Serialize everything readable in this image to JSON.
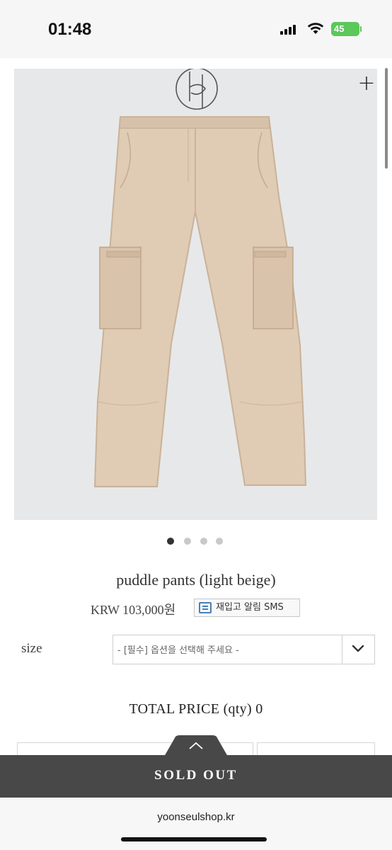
{
  "status_bar": {
    "time": "01:48",
    "battery": "45"
  },
  "gallery": {
    "image_count": 4,
    "active_index": 0,
    "zoom_label": "+"
  },
  "product": {
    "name": "puddle pants (light beige)",
    "price": "KRW 103,000원",
    "restock_button": "재입고 알림 SMS"
  },
  "options": {
    "label": "size",
    "select_placeholder": "- [필수] 옵션을 선택해 주세요 -"
  },
  "total": {
    "label": "TOTAL PRICE (qty) 0"
  },
  "actions": {
    "sold_out": "SOLD OUT"
  },
  "browser": {
    "url": "yoonseulshop.kr"
  },
  "colors": {
    "product_beige": "#e0cbb4",
    "sold_out_bar": "#484848",
    "battery_green": "#5cc75a"
  }
}
